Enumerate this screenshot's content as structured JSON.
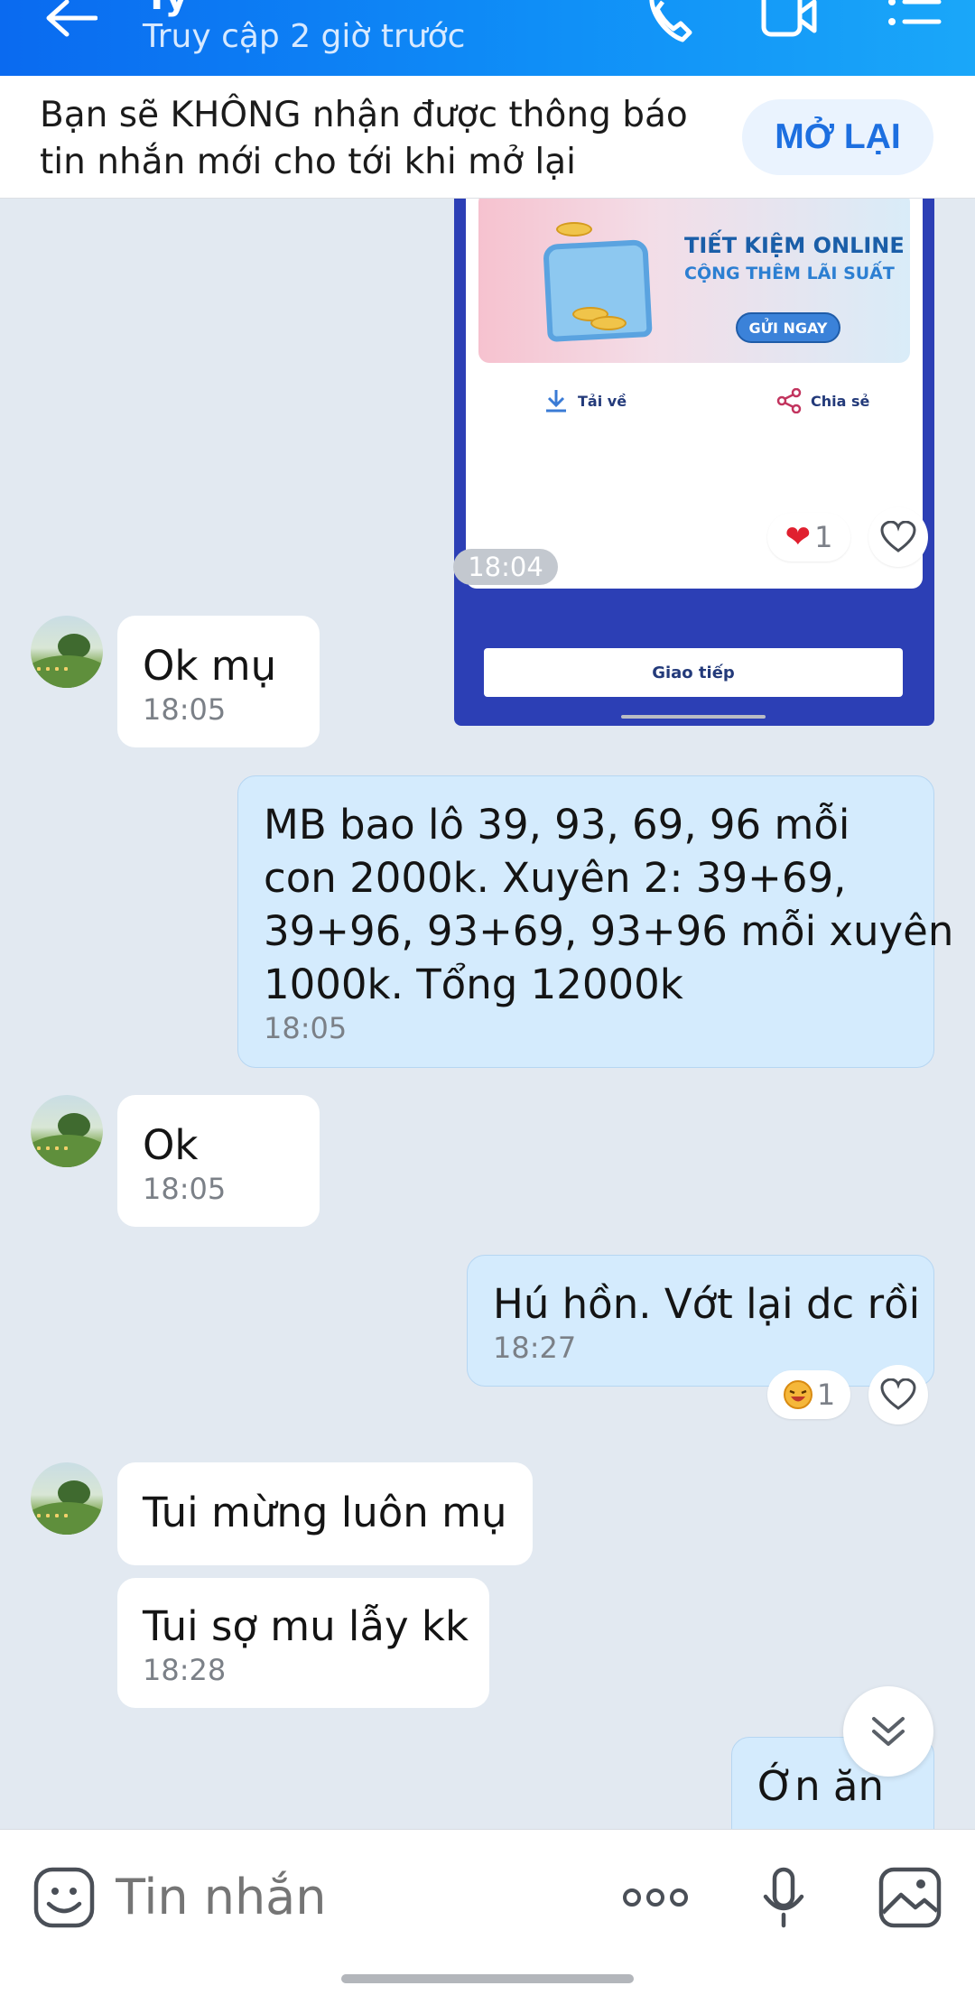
{
  "header": {
    "contact_name": "Ty",
    "status": "Truy cập 2 giờ trước",
    "icons": [
      "back-arrow-icon",
      "phone-icon",
      "video-icon",
      "menu-icon"
    ]
  },
  "banner": {
    "text": "Bạn sẽ KHÔNG nhận được thông báo tin nhắn mới cho tới khi mở lại",
    "button": "MỞ LẠI"
  },
  "promo_card": {
    "title_line1": "TIẾT KIỆM ONLINE",
    "title_line2": "CỘNG THÊM LÃI SUẤT",
    "cta": "GỬI NGAY",
    "download": "Tải về",
    "share": "Chia sẻ",
    "continue": "Giao tiếp",
    "reaction_count": "1"
  },
  "time_divider": "18:04",
  "messages": [
    {
      "direction": "in",
      "text": "Ok mụ",
      "time": "18:05"
    },
    {
      "direction": "out",
      "lines": [
        "MB bao lô 39, 93, 69, 96 mỗi",
        "con 2000k. Xuyên 2: 39+69,",
        "39+96, 93+69, 93+96 mỗi xuyên",
        "1000k. Tổng 12000k"
      ],
      "time": "18:05"
    },
    {
      "direction": "in",
      "text": "Ok",
      "time": "18:05"
    },
    {
      "direction": "out",
      "text": "Hú hồn. Vớt lại dc rồi",
      "time": "18:27",
      "reaction_count": "1"
    },
    {
      "direction": "in",
      "text": "Tui mừng luôn mụ"
    },
    {
      "direction": "in",
      "text": "Tui sợ mu lẫy kk",
      "time": "18:28"
    },
    {
      "direction": "out",
      "text": "Ớn ăn"
    }
  ],
  "composer": {
    "placeholder": "Tin nhắn"
  },
  "colors": {
    "header_blue": "#0a6af0",
    "outgoing_bubble": "#d4ebfd",
    "incoming_bubble": "#ffffff",
    "chat_background": "#e2e9f1",
    "accent": "#1d6fe0"
  }
}
